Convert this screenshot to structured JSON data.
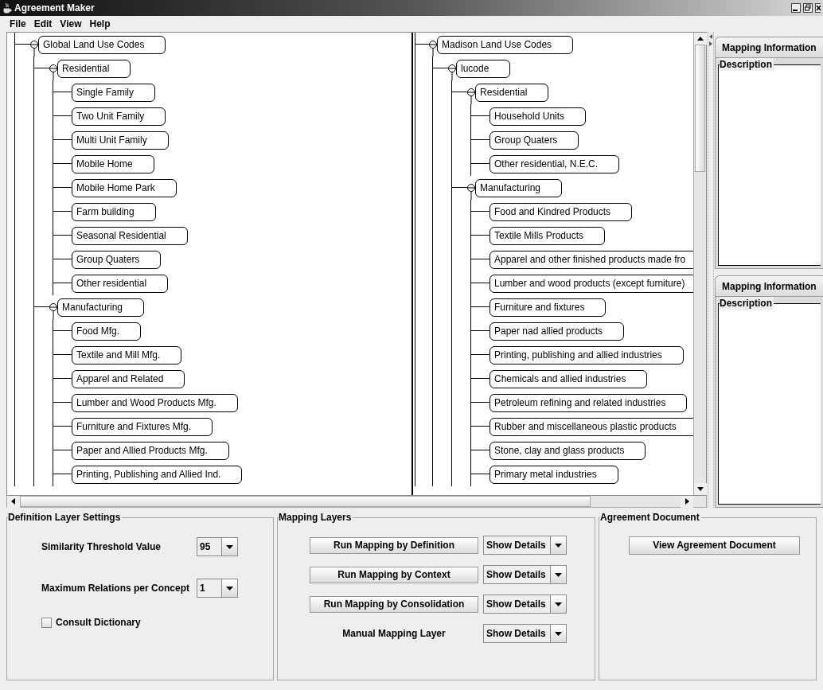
{
  "window": {
    "title": "Agreement Maker"
  },
  "menu": [
    {
      "label": "File"
    },
    {
      "label": "Edit"
    },
    {
      "label": "View"
    },
    {
      "label": "Help"
    }
  ],
  "left_tree": {
    "label": "Global Land Use Codes",
    "children": [
      {
        "label": "Residential",
        "children": [
          {
            "label": "Single Family"
          },
          {
            "label": "Two Unit Family"
          },
          {
            "label": "Multi Unit Family"
          },
          {
            "label": "Mobile Home"
          },
          {
            "label": "Mobile Home Park"
          },
          {
            "label": "Farm building"
          },
          {
            "label": "Seasonal Residential"
          },
          {
            "label": "Group Quaters"
          },
          {
            "label": "Other residential"
          }
        ]
      },
      {
        "label": "Manufacturing",
        "children": [
          {
            "label": "Food Mfg."
          },
          {
            "label": "Textile and Mill Mfg."
          },
          {
            "label": "Apparel and Related"
          },
          {
            "label": "Lumber and Wood Products Mfg."
          },
          {
            "label": "Furniture and Fixtures Mfg."
          },
          {
            "label": "Paper and Allied Products Mfg."
          },
          {
            "label": "Printing, Publishing and Allied Ind."
          }
        ]
      }
    ]
  },
  "right_tree": {
    "label": "Madison Land Use Codes",
    "children": [
      {
        "label": "lucode",
        "children": [
          {
            "label": "Residential",
            "children": [
              {
                "label": "Household Units"
              },
              {
                "label": "Group Quaters"
              },
              {
                "label": "Other residential, N.E.C."
              }
            ]
          },
          {
            "label": "Manufacturing",
            "children": [
              {
                "label": "Food and Kindred Products"
              },
              {
                "label": "Textile Mills Products"
              },
              {
                "label": "Apparel and other finished products made fro"
              },
              {
                "label": "Lumber and wood products (except furniture)"
              },
              {
                "label": "Furniture and fixtures"
              },
              {
                "label": "Paper nad allied products"
              },
              {
                "label": "Printing, publishing and allied industries"
              },
              {
                "label": "Chemicals and allied industries"
              },
              {
                "label": "Petroleum refining and related industries"
              },
              {
                "label": "Rubber and miscellaneous plastic products"
              },
              {
                "label": "Stone, clay and glass products"
              },
              {
                "label": "Primary metal industries"
              }
            ]
          }
        ]
      }
    ]
  },
  "info_panels": [
    {
      "tab": "Mapping Information",
      "group": "Description"
    },
    {
      "tab": "Mapping Information",
      "group": "Description"
    }
  ],
  "definition_settings": {
    "title": "Definition Layer Settings",
    "threshold": {
      "label": "Similarity Threshold Value",
      "value": "95"
    },
    "max_relations": {
      "label": "Maximum Relations per Concept",
      "value": "1"
    },
    "dictionary": {
      "label": "Consult Dictionary",
      "checked": false
    }
  },
  "mapping_layers": {
    "title": "Mapping Layers",
    "layers": [
      {
        "kind": "button",
        "label": "Run Mapping by Definition",
        "details": "Show Details"
      },
      {
        "kind": "button",
        "label": "Run Mapping by Context",
        "details": "Show Details"
      },
      {
        "kind": "button",
        "label": "Run Mapping by Consolidation",
        "details": "Show Details"
      },
      {
        "kind": "label",
        "label": "Manual Mapping Layer",
        "details": "Show Details"
      }
    ]
  },
  "agreement_document": {
    "title": "Agreement Document",
    "button": "View Agreement Document"
  }
}
